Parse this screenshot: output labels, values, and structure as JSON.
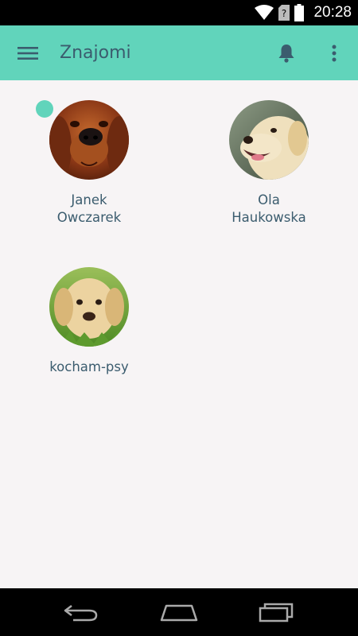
{
  "status_bar": {
    "time": "20:28",
    "icons": [
      "wifi-icon",
      "sim-unknown-icon",
      "battery-icon"
    ]
  },
  "app_bar": {
    "title": "Znajomi",
    "background": "#61d4bb",
    "icons": [
      "menu-icon",
      "bell-icon",
      "more-vert-icon"
    ]
  },
  "friends": [
    {
      "name": "Janek\nOwczarek",
      "online": true,
      "avatar": "red-setter-dog"
    },
    {
      "name": "Ola\nHaukowska",
      "online": false,
      "avatar": "yellow-labrador-dog"
    },
    {
      "name": "kocham-psy",
      "online": false,
      "avatar": "labrador-puppy-dog"
    }
  ],
  "nav_bar": {
    "icons": [
      "back-icon",
      "home-icon",
      "recents-icon"
    ]
  }
}
